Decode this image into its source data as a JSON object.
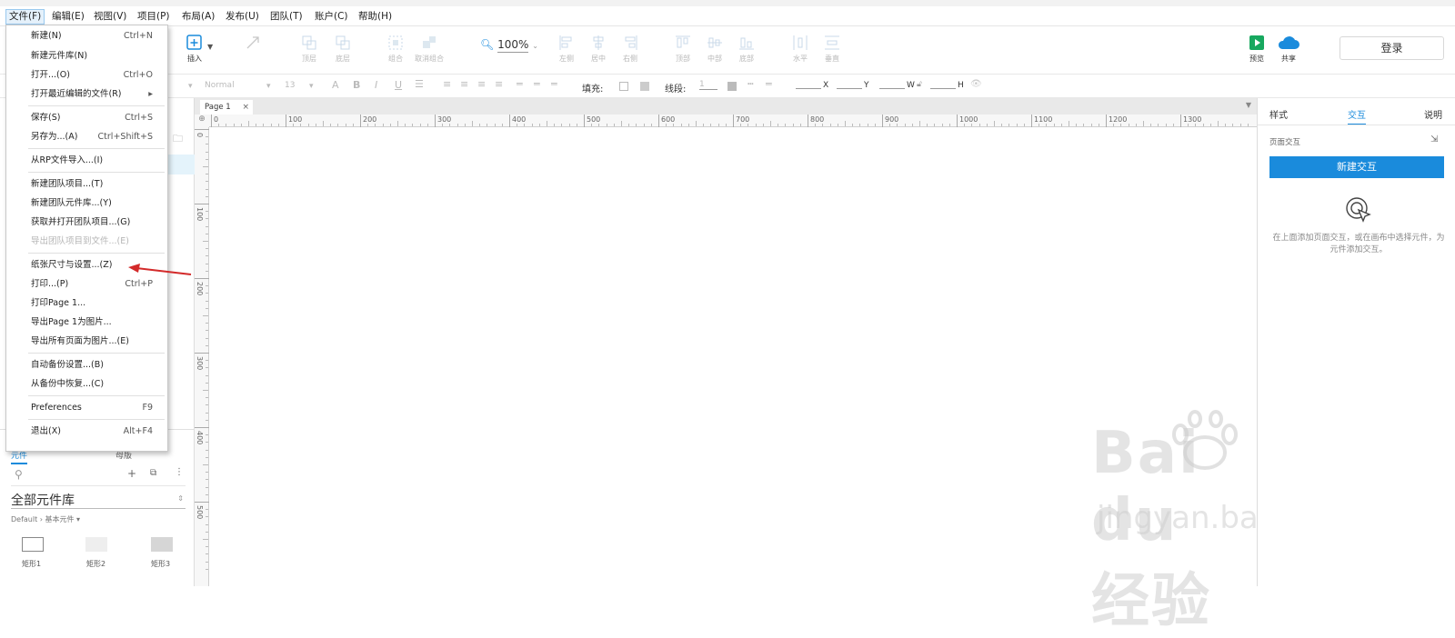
{
  "menubar": {
    "items": [
      {
        "label": "文件(F)",
        "active": true
      },
      {
        "label": "编辑(E)"
      },
      {
        "label": "视图(V)"
      },
      {
        "label": "项目(P)"
      },
      {
        "label": "布局(A)"
      },
      {
        "label": "发布(U)"
      },
      {
        "label": "团队(T)"
      },
      {
        "label": "账户(C)"
      },
      {
        "label": "帮助(H)"
      }
    ]
  },
  "file_menu": {
    "items": [
      {
        "label": "新建(N)",
        "shortcut": "Ctrl+N"
      },
      {
        "label": "新建元件库(N)",
        "shortcut": ""
      },
      {
        "label": "打开...(O)",
        "shortcut": "Ctrl+O"
      },
      {
        "label": "打开最近编辑的文件(R)",
        "shortcut": "▸"
      },
      {
        "label": "保存(S)",
        "shortcut": "Ctrl+S"
      },
      {
        "label": "另存为...(A)",
        "shortcut": "Ctrl+Shift+S"
      },
      {
        "label": "从RP文件导入...(I)",
        "shortcut": ""
      },
      {
        "label": "新建团队项目...(T)",
        "shortcut": ""
      },
      {
        "label": "新建团队元件库...(Y)",
        "shortcut": ""
      },
      {
        "label": "获取并打开团队项目...(G)",
        "shortcut": ""
      },
      {
        "label": "导出团队项目到文件...(E)",
        "shortcut": "",
        "disabled": true
      },
      {
        "label": "纸张尺寸与设置...(Z)",
        "shortcut": ""
      },
      {
        "label": "打印...(P)",
        "shortcut": "Ctrl+P"
      },
      {
        "label": "打印Page 1...",
        "shortcut": ""
      },
      {
        "label": "导出Page 1为图片...",
        "shortcut": ""
      },
      {
        "label": "导出所有页面为图片...(E)",
        "shortcut": ""
      },
      {
        "label": "自动备份设置...(B)",
        "shortcut": ""
      },
      {
        "label": "从备份中恢复...(C)",
        "shortcut": ""
      },
      {
        "label": "Preferences",
        "shortcut": "F9"
      },
      {
        "label": "退出(X)",
        "shortcut": "Alt+F4"
      }
    ]
  },
  "toolbar": {
    "insert_label": "插入",
    "zoom": "100%",
    "buttons": [
      {
        "label": "顶层"
      },
      {
        "label": "底层"
      },
      {
        "label": "组合"
      },
      {
        "label": "取消组合"
      },
      {
        "label": "左侧"
      },
      {
        "label": "居中"
      },
      {
        "label": "右侧"
      },
      {
        "label": "顶部"
      },
      {
        "label": "中部"
      },
      {
        "label": "底部"
      },
      {
        "label": "水平"
      },
      {
        "label": "垂直"
      }
    ],
    "preview_label": "预览",
    "share_label": "共享",
    "login_label": "登录"
  },
  "formatbar": {
    "style": "Normal",
    "font_size": "13",
    "fill_label": "填充:",
    "stroke_label": "线段:",
    "stroke_value": "1",
    "x_label": "X",
    "y_label": "Y",
    "w_label": "W",
    "h_label": "H"
  },
  "canvas": {
    "page_tab": "Page 1",
    "hruler_ticks": [
      "0",
      "100",
      "200",
      "300",
      "400",
      "500",
      "600",
      "700",
      "800",
      "900",
      "1000",
      "1100",
      "1200",
      "1300"
    ],
    "vruler_ticks": [
      "0",
      "100",
      "200",
      "300",
      "400",
      "500"
    ]
  },
  "left_panel": {
    "tab_components": "元件",
    "tab_masters": "母版",
    "library_name": "全部元件库",
    "breadcrumb": "Default › 基本元件 ▾",
    "widgets": [
      "矩形1",
      "矩形2",
      "矩形3"
    ]
  },
  "right_panel": {
    "tabs": [
      "样式",
      "交互",
      "说明"
    ],
    "section_label": "页面交互",
    "new_interaction_button": "新建交互",
    "hint": "在上面添加页面交互，或在画布中选择元件，为元件添加交互。"
  },
  "watermark": {
    "brand": "Bai du 经验",
    "url": "jingyan.baidu.com"
  },
  "colors": {
    "accent": "#1a8bdc",
    "annotation_arrow": "#d32a2a",
    "preview_green": "#17a85f",
    "share_blue": "#1a8bdc"
  }
}
